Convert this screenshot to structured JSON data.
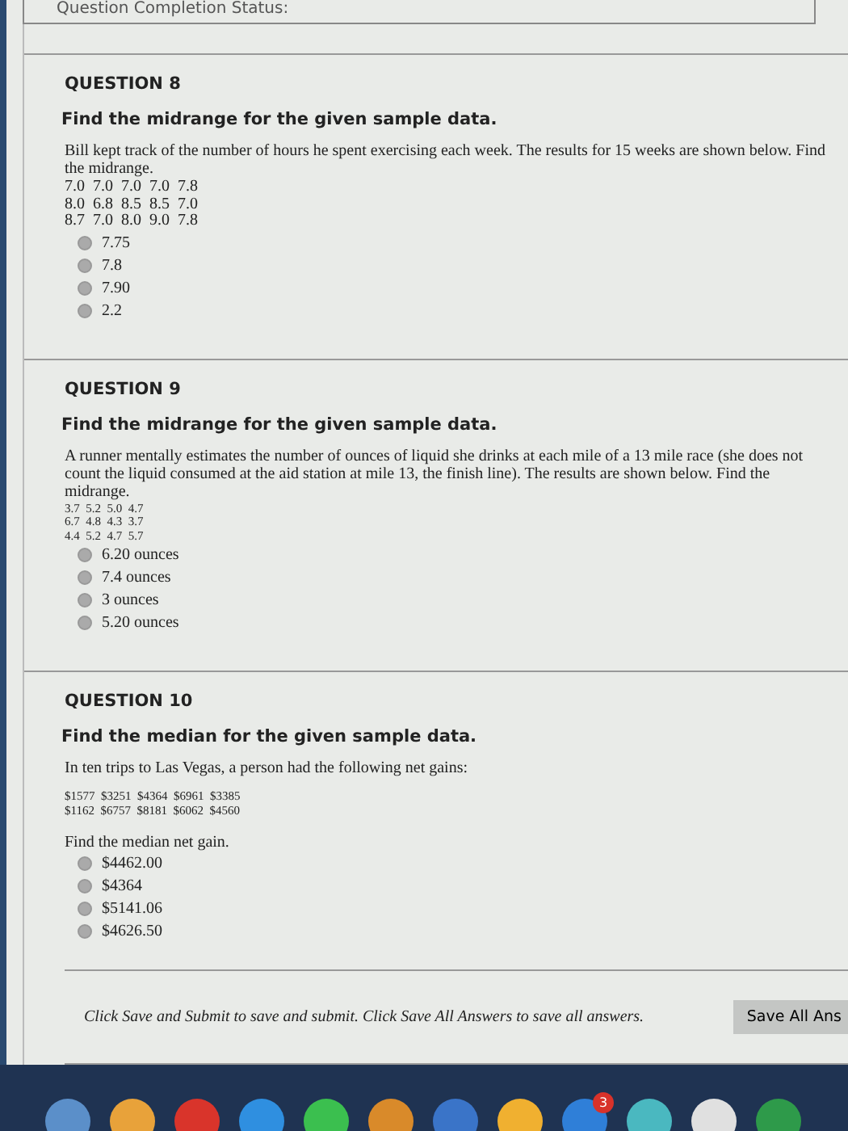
{
  "status_header": "Question Completion Status:",
  "questions": [
    {
      "number": "QUESTION 8",
      "title": "Find the midrange for the given sample data.",
      "prompt": "Bill kept track of the number of hours he spent exercising each week. The results for 15 weeks are shown below. Find the midrange.",
      "kind": "plain",
      "data_rows": [
        "7.0  7.0  7.0  7.0  7.8",
        "8.0  6.8  8.5  8.5  7.0",
        "8.7  7.0  8.0  9.0  7.8"
      ],
      "options": [
        {
          "label": "7.75",
          "selected": false
        },
        {
          "label": "7.8",
          "selected": false
        },
        {
          "label": "7.90",
          "selected": false
        },
        {
          "label": "2.2",
          "selected": false
        }
      ]
    },
    {
      "number": "QUESTION 9",
      "title": "Find the midrange for the given sample data.",
      "prompt": "A runner mentally estimates the number of ounces of liquid she drinks at each mile of a 13 mile race (she does not count the liquid consumed at the aid station at mile 13, the finish line). The results are shown below. Find the midrange.",
      "kind": "compact",
      "data_rows": [
        "3.7  5.2  5.0  4.7",
        "6.7  4.8  4.3  3.7",
        "4.4  5.2  4.7  5.7"
      ],
      "options": [
        {
          "label": "6.20 ounces",
          "selected": false
        },
        {
          "label": "7.4 ounces",
          "selected": false
        },
        {
          "label": "3 ounces",
          "selected": false
        },
        {
          "label": "5.20 ounces",
          "selected": false
        }
      ]
    },
    {
      "number": "QUESTION 10",
      "title": "Find the median for the given sample data.",
      "prompt": "In ten trips to Las Vegas, a person had the following net gains:",
      "kind": "compact",
      "data_rows": [
        "$1577  $3251  $4364  $6961  $3385",
        "$1162  $6757  $8181  $6062  $4560"
      ],
      "follow_up": "Find the median net gain.",
      "options": [
        {
          "label": "$4462.00",
          "selected": false
        },
        {
          "label": "$4364",
          "selected": false
        },
        {
          "label": "$5141.06",
          "selected": false
        },
        {
          "label": "$4626.50",
          "selected": false
        }
      ]
    }
  ],
  "footer": {
    "instructions": "Click Save and Submit to save and submit. Click Save All Answers to save all answers.",
    "button": "Save All Ans"
  },
  "dock": [
    {
      "kind": "app",
      "color": "#5b8fc9"
    },
    {
      "kind": "app",
      "color": "#e8a23a"
    },
    {
      "kind": "app",
      "color": "#d9342b"
    },
    {
      "kind": "app",
      "color": "#2f8fe0"
    },
    {
      "kind": "app",
      "color": "#3bbf4f"
    },
    {
      "kind": "app",
      "color": "#d98a2a"
    },
    {
      "kind": "app",
      "color": "#3a74c8"
    },
    {
      "kind": "app",
      "color": "#f0b030"
    },
    {
      "kind": "badged",
      "color": "#2f7fd8",
      "badge": "3"
    },
    {
      "kind": "app",
      "color": "#4ab8c0"
    },
    {
      "kind": "app",
      "color": "#e0e0e0"
    },
    {
      "kind": "app",
      "color": "#2e9a4a"
    }
  ]
}
